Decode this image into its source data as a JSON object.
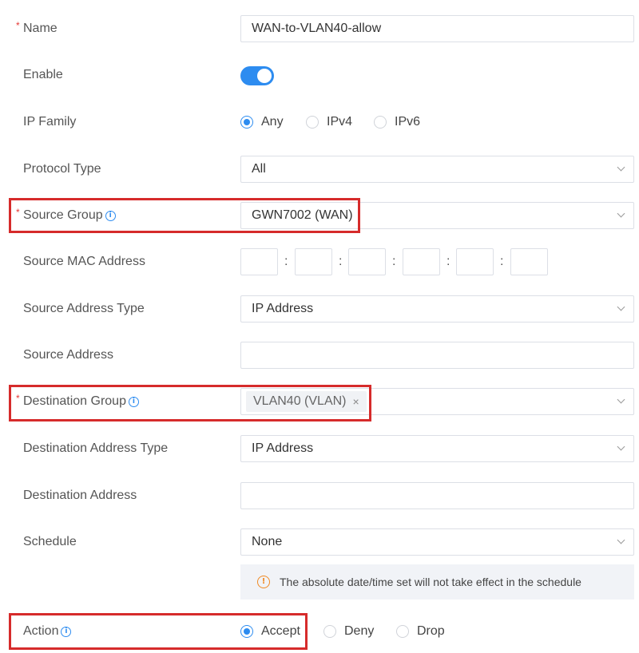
{
  "form": {
    "name": {
      "label": "Name",
      "required": "*",
      "value": "WAN-to-VLAN40-allow"
    },
    "enable": {
      "label": "Enable",
      "on": true
    },
    "ip_family": {
      "label": "IP Family",
      "options": [
        "Any",
        "IPv4",
        "IPv6"
      ],
      "selected": "Any"
    },
    "protocol_type": {
      "label": "Protocol Type",
      "value": "All"
    },
    "source_group": {
      "label": "Source Group",
      "required": "*",
      "value": "GWN7002 (WAN)"
    },
    "source_mac": {
      "label": "Source MAC Address",
      "separator": ":"
    },
    "source_address_type": {
      "label": "Source Address Type",
      "value": "IP Address"
    },
    "source_address": {
      "label": "Source Address",
      "value": ""
    },
    "destination_group": {
      "label": "Destination Group",
      "required": "*",
      "tag": "VLAN40 (VLAN)",
      "tag_remove": "×"
    },
    "destination_address_type": {
      "label": "Destination Address Type",
      "value": "IP Address"
    },
    "destination_address": {
      "label": "Destination Address",
      "value": ""
    },
    "schedule": {
      "label": "Schedule",
      "value": "None",
      "notice": "The absolute date/time set will not take effect in the schedule",
      "notice_icon": "!"
    },
    "action": {
      "label": "Action",
      "options": [
        "Accept",
        "Deny",
        "Drop"
      ],
      "selected": "Accept"
    }
  },
  "icons": {
    "info": "i"
  },
  "colors": {
    "accent": "#2d8cf0",
    "highlight": "#d62b2b",
    "warning": "#f08a24"
  }
}
